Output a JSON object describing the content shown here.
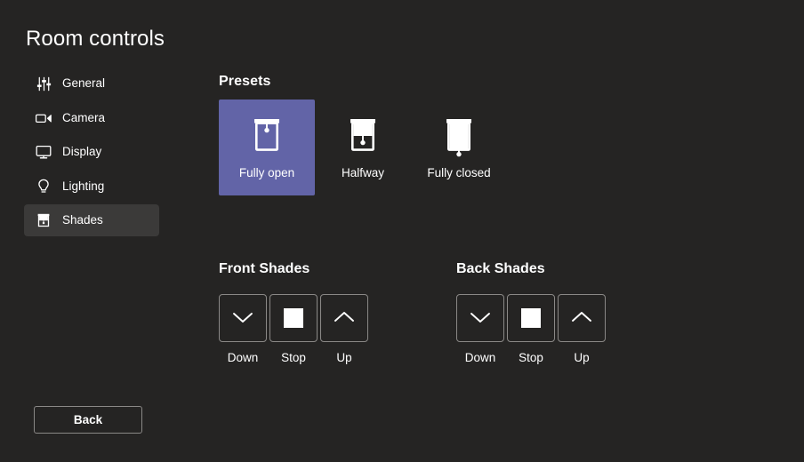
{
  "page": {
    "title": "Room controls",
    "theme_background": "#252423",
    "accent_color": "#6264a7",
    "selected_nav_background": "#3b3a39",
    "border_color": "#8a8886"
  },
  "sidebar": {
    "items": [
      {
        "label": "General",
        "icon": "sliders-icon",
        "selected": false
      },
      {
        "label": "Camera",
        "icon": "camera-icon",
        "selected": false
      },
      {
        "label": "Display",
        "icon": "monitor-icon",
        "selected": false
      },
      {
        "label": "Lighting",
        "icon": "lightbulb-icon",
        "selected": false
      },
      {
        "label": "Shades",
        "icon": "shade-icon",
        "selected": true
      }
    ]
  },
  "footer": {
    "back_label": "Back"
  },
  "presets": {
    "heading": "Presets",
    "items": [
      {
        "label": "Fully open",
        "icon": "shade-fully-open-icon",
        "selected": true
      },
      {
        "label": "Halfway",
        "icon": "shade-halfway-icon",
        "selected": false
      },
      {
        "label": "Fully closed",
        "icon": "shade-fully-closed-icon",
        "selected": false
      }
    ]
  },
  "shade_groups": [
    {
      "heading": "Front Shades",
      "buttons": [
        {
          "label": "Down",
          "icon": "chevron-down-icon"
        },
        {
          "label": "Stop",
          "icon": "stop-square-icon"
        },
        {
          "label": "Up",
          "icon": "chevron-up-icon"
        }
      ]
    },
    {
      "heading": "Back Shades",
      "buttons": [
        {
          "label": "Down",
          "icon": "chevron-down-icon"
        },
        {
          "label": "Stop",
          "icon": "stop-square-icon"
        },
        {
          "label": "Up",
          "icon": "chevron-up-icon"
        }
      ]
    }
  ]
}
